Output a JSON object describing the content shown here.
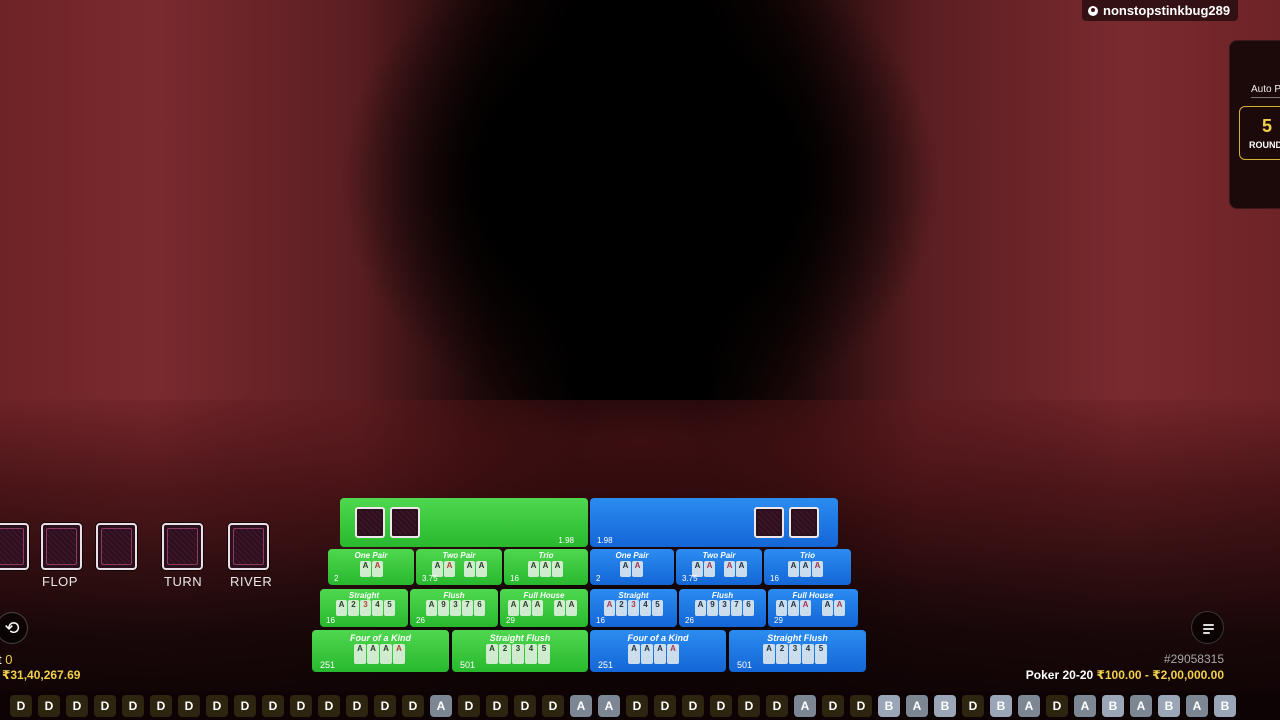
{
  "user": {
    "username": "nonstopstinkbug289"
  },
  "autoplay": {
    "label": "Auto P",
    "rounds_value": "5",
    "rounds_label": "ROUNDS"
  },
  "community": {
    "flop_label": "FLOP",
    "turn_label": "TURN",
    "river_label": "RIVER"
  },
  "board": {
    "player_a": {
      "color": "#2fc336",
      "hand_odds": "1.98",
      "one_pair": {
        "title": "One Pair",
        "odds": "2",
        "cards": [
          "A",
          "A"
        ]
      },
      "two_pair": {
        "title": "Two Pair",
        "odds": "3.75",
        "cards": [
          "A",
          "A",
          "A",
          "A"
        ]
      },
      "trio": {
        "title": "Trio",
        "odds": "16",
        "cards": [
          "A",
          "A",
          "A"
        ]
      },
      "straight": {
        "title": "Straight",
        "odds": "16",
        "cards": [
          "A",
          "2",
          "3",
          "4",
          "5"
        ]
      },
      "flush": {
        "title": "Flush",
        "odds": "26",
        "cards": [
          "A",
          "9",
          "3",
          "7",
          "6"
        ]
      },
      "full_house": {
        "title": "Full House",
        "odds": "29",
        "cards": [
          "A",
          "A",
          "A",
          "A",
          "A"
        ]
      },
      "four_kind": {
        "title": "Four of a Kind",
        "odds": "251",
        "cards": [
          "A",
          "A",
          "A",
          "A"
        ]
      },
      "straight_flush": {
        "title": "Straight Flush",
        "odds": "501",
        "cards": [
          "A",
          "2",
          "3",
          "4",
          "5"
        ]
      }
    },
    "player_b": {
      "color": "#1a78e6",
      "hand_odds": "1.98",
      "one_pair": {
        "title": "One Pair",
        "odds": "2",
        "cards": [
          "A",
          "A"
        ]
      },
      "two_pair": {
        "title": "Two Pair",
        "odds": "3.75",
        "cards": [
          "A",
          "A",
          "A",
          "A"
        ]
      },
      "trio": {
        "title": "Trio",
        "odds": "16",
        "cards": [
          "A",
          "A",
          "A"
        ]
      },
      "straight": {
        "title": "Straight",
        "odds": "16",
        "cards": [
          "A",
          "2",
          "3",
          "4",
          "5"
        ]
      },
      "flush": {
        "title": "Flush",
        "odds": "26",
        "cards": [
          "A",
          "9",
          "3",
          "7",
          "6"
        ]
      },
      "full_house": {
        "title": "Full House",
        "odds": "29",
        "cards": [
          "A",
          "A",
          "A",
          "A",
          "A"
        ]
      },
      "four_kind": {
        "title": "Four of a Kind",
        "odds": "251",
        "cards": [
          "A",
          "A",
          "A",
          "A"
        ]
      },
      "straight_flush": {
        "title": "Straight Flush",
        "odds": "501",
        "cards": [
          "A",
          "2",
          "3",
          "4",
          "5"
        ]
      }
    }
  },
  "footer": {
    "bet_label": "t",
    "bet_value": "0",
    "balance": "₹31,40,267.69",
    "round_id": "#29058315",
    "table_name": "Poker 20-20",
    "limits": "₹100.00 - ₹2,00,000.00"
  },
  "results_road": [
    "D",
    "D",
    "D",
    "D",
    "D",
    "D",
    "D",
    "D",
    "D",
    "D",
    "D",
    "D",
    "D",
    "D",
    "D",
    "A",
    "D",
    "D",
    "D",
    "D",
    "A",
    "A",
    "D",
    "D",
    "D",
    "D",
    "D",
    "D",
    "A",
    "D",
    "D",
    "B",
    "A",
    "B",
    "D",
    "B",
    "A",
    "D",
    "A",
    "B",
    "A",
    "B",
    "A",
    "B"
  ],
  "icons": {
    "history": "history-icon",
    "menu": "menu-icon",
    "user": "user-icon"
  }
}
